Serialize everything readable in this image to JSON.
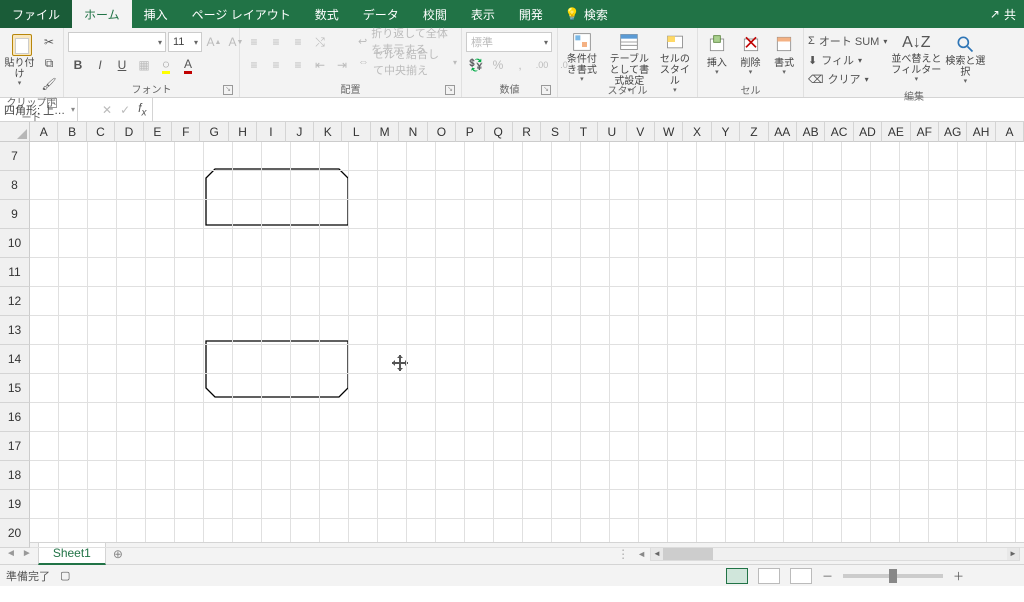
{
  "tabs": {
    "file": "ファイル",
    "home": "ホーム",
    "insert": "挿入",
    "pagelayout": "ページ レイアウト",
    "formulas": "数式",
    "data": "データ",
    "review": "校閲",
    "view": "表示",
    "developer": "開発",
    "search": "検索"
  },
  "share": "共",
  "ribbon": {
    "clipboard": {
      "label": "クリップボード",
      "paste": "貼り付け"
    },
    "font": {
      "label": "フォント",
      "name": "",
      "size": "11",
      "bold": "B",
      "italic": "I",
      "underline": "U"
    },
    "alignment": {
      "label": "配置",
      "wrap": "折り返して全体を表示する",
      "merge": "セルを結合して中央揃え"
    },
    "number": {
      "label": "数値",
      "format": "標準"
    },
    "styles": {
      "label": "スタイル",
      "cond": "条件付き書式",
      "table": "テーブルとして書式設定",
      "cell": "セルのスタイル"
    },
    "cells": {
      "label": "セル",
      "insert": "挿入",
      "delete": "削除",
      "format": "書式"
    },
    "editing": {
      "label": "編集",
      "autosum": "オート SUM",
      "fill": "フィル",
      "clear": "クリア",
      "sort": "並べ替えとフィルター",
      "find": "検索と選択"
    }
  },
  "namebox": "四角形: 上…",
  "columns": [
    "A",
    "B",
    "C",
    "D",
    "E",
    "F",
    "G",
    "H",
    "I",
    "J",
    "K",
    "L",
    "M",
    "N",
    "O",
    "P",
    "Q",
    "R",
    "S",
    "T",
    "U",
    "V",
    "W",
    "X",
    "Y",
    "Z",
    "AA",
    "AB",
    "AC",
    "AD",
    "AE",
    "AF",
    "AG",
    "AH",
    "A"
  ],
  "rows": [
    "7",
    "8",
    "9",
    "10",
    "11",
    "12",
    "13",
    "14",
    "15",
    "16",
    "17",
    "18",
    "19",
    "20"
  ],
  "sheet": {
    "name": "Sheet1"
  },
  "status": {
    "ready": "準備完了",
    "zoom_minus": "－",
    "zoom_plus": "＋",
    "zoom": ""
  }
}
